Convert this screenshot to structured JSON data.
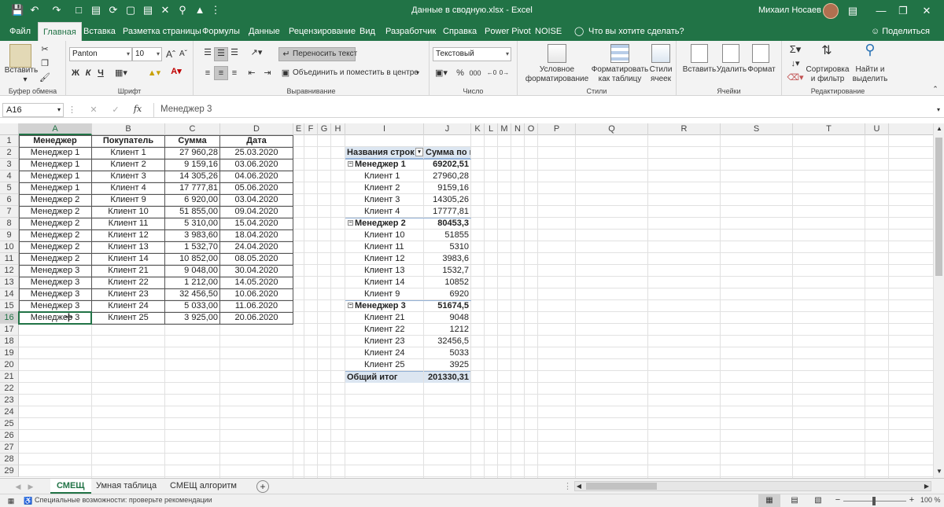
{
  "titlebar": {
    "title": "Данные в сводную.xlsx - Excel",
    "user": "Михаил Носаев"
  },
  "tabs": [
    "Файл",
    "Главная",
    "Вставка",
    "Разметка страницы",
    "Формулы",
    "Данные",
    "Рецензирование",
    "Вид",
    "Разработчик",
    "Справка",
    "Power Pivot",
    "NOISE"
  ],
  "active_tab": "Главная",
  "tellme": "Что вы хотите сделать?",
  "share": "Поделиться",
  "ribbon": {
    "paste": "Вставить",
    "clipboard": "Буфер обмена",
    "font_name": "Panton",
    "font_size": "10",
    "bold": "Ж",
    "italic": "К",
    "underline": "Ч",
    "font_group": "Шрифт",
    "wrap_text": "Переносить текст",
    "merge": "Объединить и поместить в центре",
    "align_group": "Выравнивание",
    "number_format": "Текстовый",
    "percent": "%",
    "thousands": "000",
    "number_group": "Число",
    "cond_format_1": "Условное",
    "cond_format_2": "форматирование",
    "format_table_1": "Форматировать",
    "format_table_2": "как таблицу",
    "cell_styles_1": "Стили",
    "cell_styles_2": "ячеек",
    "styles_group": "Стили",
    "insert": "Вставить",
    "delete": "Удалить",
    "format": "Формат",
    "cells_group": "Ячейки",
    "sort_1": "Сортировка",
    "sort_2": "и фильтр",
    "find_1": "Найти и",
    "find_2": "выделить",
    "edit_group": "Редактирование"
  },
  "formula_bar": {
    "name_box": "A16",
    "formula": "Менеджер 3"
  },
  "columns": [
    "A",
    "B",
    "C",
    "D",
    "E",
    "F",
    "G",
    "H",
    "I",
    "J",
    "K",
    "L",
    "M",
    "N",
    "O",
    "P",
    "Q",
    "R",
    "S",
    "T",
    "U"
  ],
  "rows": [
    "1",
    "2",
    "3",
    "4",
    "5",
    "6",
    "7",
    "8",
    "9",
    "10",
    "11",
    "12",
    "13",
    "14",
    "15",
    "16",
    "17",
    "18",
    "19",
    "20",
    "21",
    "22",
    "23",
    "24",
    "25",
    "26",
    "27",
    "28",
    "29"
  ],
  "table": {
    "headers": [
      "Менеджер",
      "Покупатель",
      "Сумма",
      "Дата"
    ],
    "rows": [
      [
        "Менеджер 1",
        "Клиент 1",
        "27 960,28",
        "25.03.2020"
      ],
      [
        "Менеджер 1",
        "Клиент 2",
        "9 159,16",
        "03.06.2020"
      ],
      [
        "Менеджер 1",
        "Клиент 3",
        "14 305,26",
        "04.06.2020"
      ],
      [
        "Менеджер 1",
        "Клиент 4",
        "17 777,81",
        "05.06.2020"
      ],
      [
        "Менеджер 2",
        "Клиент 9",
        "6 920,00",
        "03.04.2020"
      ],
      [
        "Менеджер 2",
        "Клиент 10",
        "51 855,00",
        "09.04.2020"
      ],
      [
        "Менеджер 2",
        "Клиент 11",
        "5 310,00",
        "15.04.2020"
      ],
      [
        "Менеджер 2",
        "Клиент 12",
        "3 983,60",
        "18.04.2020"
      ],
      [
        "Менеджер 2",
        "Клиент 13",
        "1 532,70",
        "24.04.2020"
      ],
      [
        "Менеджер 2",
        "Клиент 14",
        "10 852,00",
        "08.05.2020"
      ],
      [
        "Менеджер 3",
        "Клиент 21",
        "9 048,00",
        "30.04.2020"
      ],
      [
        "Менеджер 3",
        "Клиент 22",
        "1 212,00",
        "14.05.2020"
      ],
      [
        "Менеджер 3",
        "Клиент 23",
        "32 456,50",
        "10.06.2020"
      ],
      [
        "Менеджер 3",
        "Клиент 24",
        "5 033,00",
        "11.06.2020"
      ],
      [
        "Менеджер 3",
        "Клиент 25",
        "3 925,00",
        "20.06.2020"
      ]
    ]
  },
  "pivot": {
    "header_label": "Названия строк",
    "header_value": "Сумма по полю Сумма",
    "groups": [
      {
        "name": "Менеджер 1",
        "total": "69202,51",
        "items": [
          [
            "Клиент 1",
            "27960,28"
          ],
          [
            "Клиент 2",
            "9159,16"
          ],
          [
            "Клиент 3",
            "14305,26"
          ],
          [
            "Клиент 4",
            "17777,81"
          ]
        ]
      },
      {
        "name": "Менеджер 2",
        "total": "80453,3",
        "items": [
          [
            "Клиент 10",
            "51855"
          ],
          [
            "Клиент 11",
            "5310"
          ],
          [
            "Клиент 12",
            "3983,6"
          ],
          [
            "Клиент 13",
            "1532,7"
          ],
          [
            "Клиент 14",
            "10852"
          ],
          [
            "Клиент 9",
            "6920"
          ]
        ]
      },
      {
        "name": "Менеджер 3",
        "total": "51674,5",
        "items": [
          [
            "Клиент 21",
            "9048"
          ],
          [
            "Клиент 22",
            "1212"
          ],
          [
            "Клиент 23",
            "32456,5"
          ],
          [
            "Клиент 24",
            "5033"
          ],
          [
            "Клиент 25",
            "3925"
          ]
        ]
      }
    ],
    "grand_label": "Общий итог",
    "grand_value": "201330,31"
  },
  "sheets": [
    "СМЕЩ",
    "Умная таблица",
    "СМЕЩ алгоритм"
  ],
  "active_sheet": "СМЕЩ",
  "status": {
    "accessibility": "Специальные возможности: проверьте рекомендации",
    "zoom": "100 %"
  }
}
